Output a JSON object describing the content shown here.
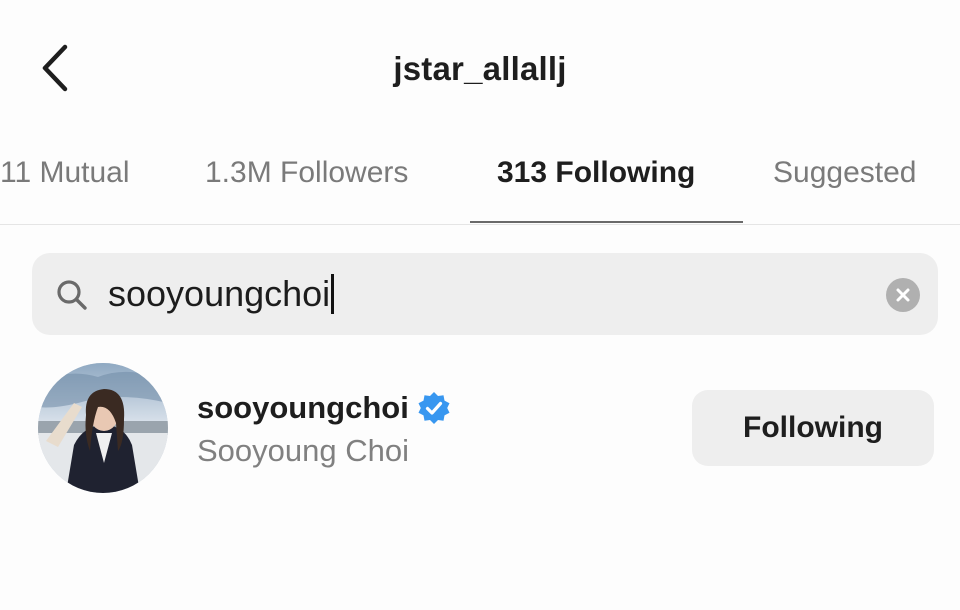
{
  "header": {
    "title": "jstar_allallj",
    "back_icon": "chevron-left-icon"
  },
  "tabs": [
    {
      "label": "11 Mutual",
      "active": false
    },
    {
      "label": "1.3M Followers",
      "active": false
    },
    {
      "label": "313 Following",
      "active": true
    },
    {
      "label": "Suggested",
      "active": false
    }
  ],
  "search": {
    "value": "sooyoungchoi",
    "icon": "search-icon",
    "clear_icon": "clear-icon"
  },
  "results": [
    {
      "username": "sooyoungchoi",
      "full_name": "Sooyoung Choi",
      "verified": true,
      "button_label": "Following"
    }
  ],
  "colors": {
    "verified_badge": "#3897f0",
    "search_bg": "#eeeeee",
    "button_bg": "#eeeeee",
    "muted_text": "#7a7a7a"
  }
}
